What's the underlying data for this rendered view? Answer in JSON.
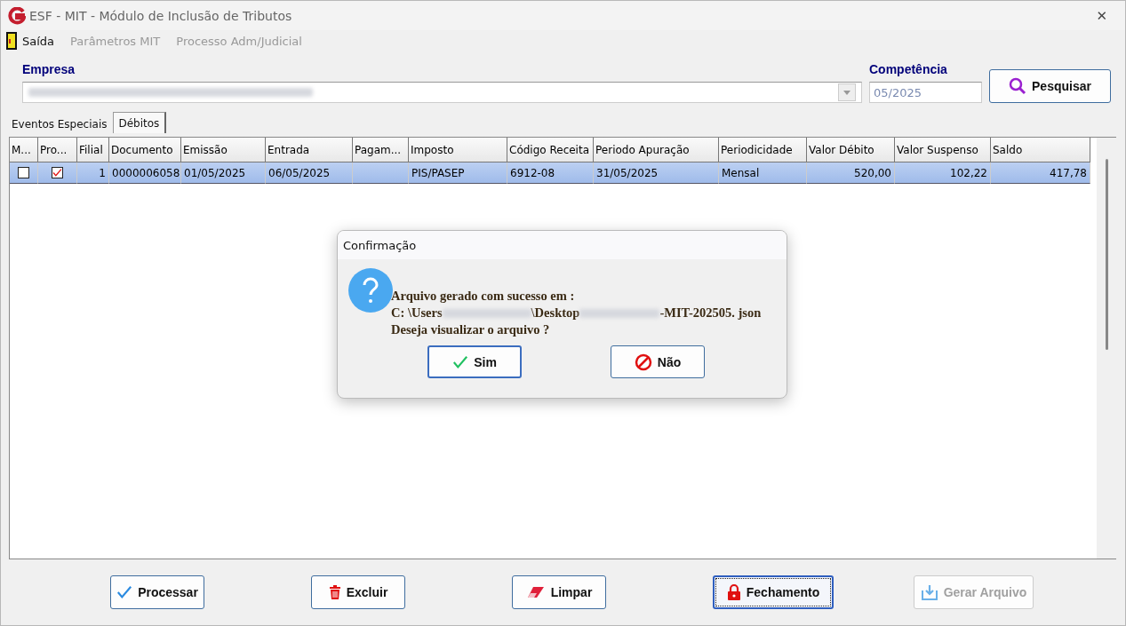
{
  "window": {
    "title": "ESF - MIT - Módulo de Inclusão de Tributos",
    "close": "✕"
  },
  "menu": [
    {
      "label": "Saída",
      "disabled": false
    },
    {
      "label": "Parâmetros MIT",
      "disabled": true
    },
    {
      "label": "Processo Adm/Judicial",
      "disabled": true
    }
  ],
  "empresa": {
    "label": "Empresa"
  },
  "competencia": {
    "label": "Competência",
    "value": "05/2025"
  },
  "search_button": {
    "label": "Pesquisar"
  },
  "tabs": [
    {
      "label": "Eventos Especiais",
      "selected": false
    },
    {
      "label": "Débitos",
      "selected": true
    }
  ],
  "table": {
    "columns": [
      {
        "label": "M...",
        "kind": "check"
      },
      {
        "label": "Pro...",
        "kind": "check"
      },
      {
        "label": "Filial",
        "kind": "right"
      },
      {
        "label": "Documento",
        "kind": "text"
      },
      {
        "label": "Emissão",
        "kind": "text"
      },
      {
        "label": "Entrada",
        "kind": "text"
      },
      {
        "label": "Pagam...",
        "kind": "text"
      },
      {
        "label": "Imposto",
        "kind": "text"
      },
      {
        "label": "Código Receita",
        "kind": "text"
      },
      {
        "label": "Periodo Apuração",
        "kind": "text"
      },
      {
        "label": "Periodicidade",
        "kind": "text"
      },
      {
        "label": "Valor Débito",
        "kind": "right"
      },
      {
        "label": "Valor Suspenso",
        "kind": "right"
      },
      {
        "label": "Saldo",
        "kind": "right"
      }
    ],
    "rows": [
      {
        "selected": true,
        "checks": [
          false,
          true
        ],
        "cells": [
          "",
          "",
          "1",
          "0000006058",
          "01/05/2025",
          "06/05/2025",
          "",
          "PIS/PASEP",
          "6912-08",
          "31/05/2025",
          "Mensal",
          "520,00",
          "102,22",
          "417,78"
        ]
      }
    ]
  },
  "dialog": {
    "title": "Confirmação",
    "line_1": "Arquivo gerado com sucesso em :",
    "path_parts": [
      "C: \\Users",
      "\\Desktop",
      "-MIT-202505. json"
    ],
    "line_3": "Deseja visualizar o arquivo ?",
    "buttons": [
      {
        "label": "Sim",
        "default": true
      },
      {
        "label": "Não",
        "default": false
      }
    ]
  },
  "buttons": [
    {
      "label": "Processar",
      "disabled": false,
      "focused": false
    },
    {
      "label": "Excluir",
      "disabled": false,
      "focused": false
    },
    {
      "label": "Limpar",
      "disabled": false,
      "focused": false
    },
    {
      "label": "Fechamento",
      "disabled": false,
      "focused": true
    },
    {
      "label": "Gerar Arquivo",
      "disabled": true,
      "focused": false
    }
  ]
}
